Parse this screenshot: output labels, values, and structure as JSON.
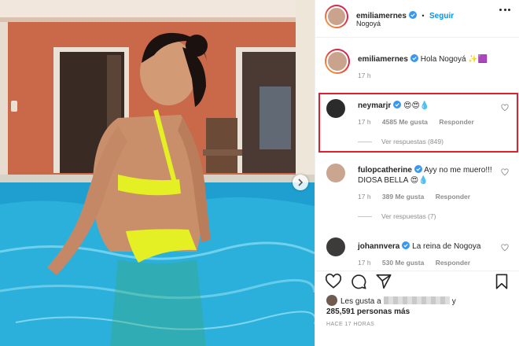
{
  "post": {
    "author": "emiliamernes",
    "follow_label": "Seguir",
    "separator": "•",
    "location": "Nogoyá"
  },
  "caption": {
    "username": "emiliamernes",
    "text": "Hola Nogoyá ✨🟪",
    "time": "17 h"
  },
  "comments": [
    {
      "username": "neymarjr",
      "text": "😍😍💧",
      "time": "17 h",
      "likes": "4585 Me gusta",
      "reply_label": "Responder",
      "replies": "Ver respuestas (849)"
    },
    {
      "username": "fulopcatherine",
      "text": "Ayy no me muero!!! DIOSA BELLA 😍💧",
      "time": "17 h",
      "likes": "389 Me gusta",
      "reply_label": "Responder",
      "replies": "Ver respuestas (7)"
    },
    {
      "username": "johannvera",
      "text": "La reina de Nogoya",
      "time": "17 h",
      "likes": "530 Me gusta",
      "reply_label": "Responder"
    }
  ],
  "likes_summary": {
    "prefix": "Les gusta a",
    "conj": "y",
    "count": "285,591 personas más"
  },
  "time_ago": "HACE 17 HORAS",
  "colors": {
    "accent": "#0095f6",
    "highlight": "#e0202e",
    "verified": "#3897f0"
  }
}
